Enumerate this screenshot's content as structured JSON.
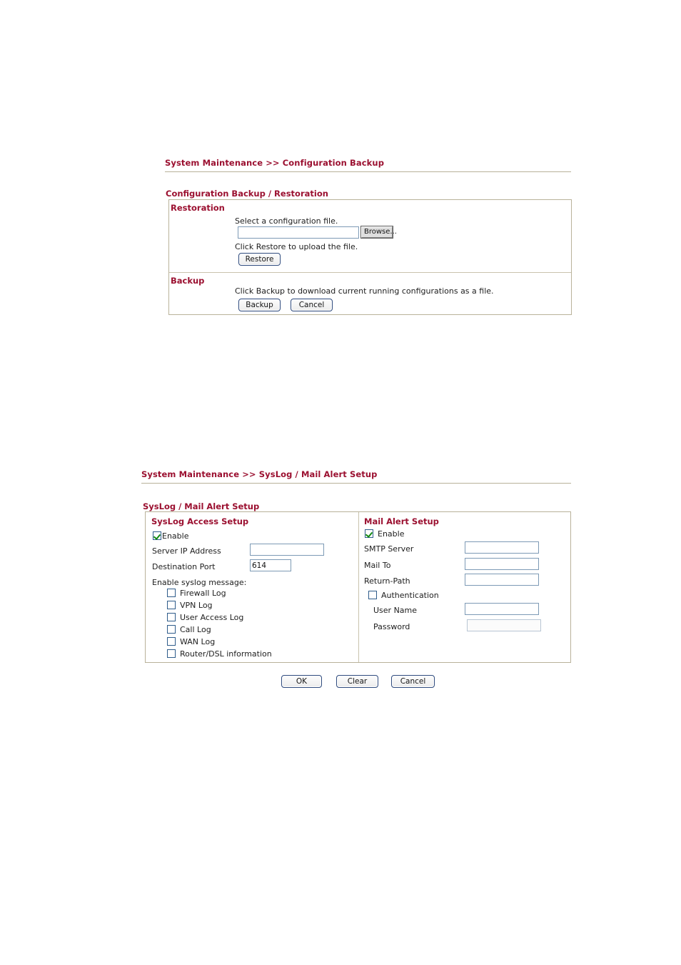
{
  "page": {
    "background": "#ffffff",
    "accent_color": "#9b1030",
    "border_color": "#b9b29a",
    "input_border_color": "#7d9ab5",
    "button_border_color": "#2e4a7d"
  },
  "config_backup": {
    "breadcrumb": "System Maintenance >> Configuration Backup",
    "section_label": "Configuration Backup / Restoration",
    "restoration": {
      "label": "Restoration",
      "select_text": "Select a configuration file.",
      "file_input_value": "",
      "file_input_placeholder": "",
      "browse_label": "Browse...",
      "click_restore_text": "Click Restore to upload the file.",
      "restore_label": "Restore"
    },
    "backup": {
      "label": "Backup",
      "click_backup_text": "Click Backup to download current running configurations as a file.",
      "backup_label": "Backup",
      "cancel_label": "Cancel"
    }
  },
  "syslog": {
    "breadcrumb": "System Maintenance >> SysLog / Mail Alert Setup",
    "section_label": "SysLog / Mail Alert Setup",
    "access_setup": {
      "title": "SysLog Access Setup",
      "enable_label": "Enable",
      "enable_checked": true,
      "server_ip_label": "Server IP Address",
      "server_ip_value": "",
      "destination_port_label": "Destination Port",
      "destination_port_value": "614",
      "enable_message_label": "Enable syslog message:",
      "log_options": [
        {
          "label": "Firewall Log",
          "checked": false
        },
        {
          "label": "VPN Log",
          "checked": false
        },
        {
          "label": "User Access Log",
          "checked": false
        },
        {
          "label": "Call Log",
          "checked": false
        },
        {
          "label": "WAN Log",
          "checked": false
        },
        {
          "label": "Router/DSL information",
          "checked": false
        }
      ]
    },
    "mail_alert": {
      "title": "Mail Alert Setup",
      "enable_label": "Enable",
      "enable_checked": true,
      "smtp_server_label": "SMTP Server",
      "smtp_server_value": "",
      "mail_to_label": "Mail To",
      "mail_to_value": "",
      "return_path_label": "Return-Path",
      "return_path_value": "",
      "authentication_label": "Authentication",
      "authentication_checked": false,
      "user_name_label": "User Name",
      "user_name_value": "",
      "password_label": "Password",
      "password_value": ""
    },
    "actions": {
      "ok_label": "OK",
      "clear_label": "Clear",
      "cancel_label": "Cancel"
    }
  }
}
